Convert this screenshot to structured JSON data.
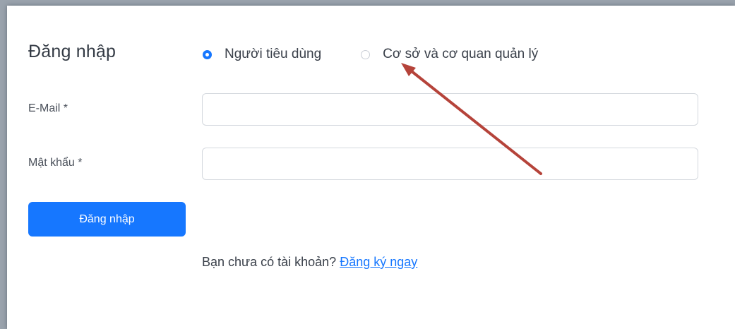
{
  "login_form": {
    "title": "Đăng nhập",
    "user_types": [
      {
        "label": "Người tiêu dùng",
        "selected": true
      },
      {
        "label": "Cơ sở và cơ quan quản lý",
        "selected": false
      }
    ],
    "email": {
      "label": "E-Mail *",
      "value": "",
      "placeholder": ""
    },
    "password": {
      "label": "Mật khẩu *",
      "value": "",
      "placeholder": ""
    },
    "submit_label": "Đăng nhập",
    "signup_prompt": "Bạn chưa có tài khoản?",
    "signup_link": "Đăng ký ngay"
  },
  "colors": {
    "accent": "#1677ff",
    "annotation_arrow": "#b5433a"
  },
  "annotation": {
    "arrow_icon": "red-arrow-icon",
    "target": "radio-option-co-so-va-co-quan-quan-ly"
  }
}
